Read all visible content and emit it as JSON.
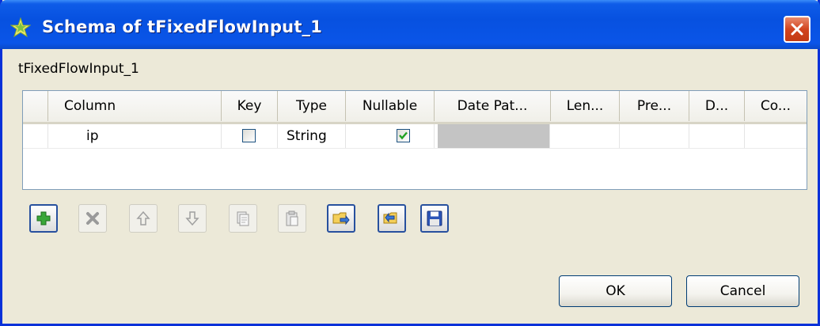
{
  "window": {
    "title": "Schema of tFixedFlowInput_1"
  },
  "component_label": "tFixedFlowInput_1",
  "table": {
    "columns": [
      "Column",
      "Key",
      "Type",
      "Nullable",
      "Date Pat...",
      "Len...",
      "Pre...",
      "D...",
      "Co..."
    ],
    "rows": [
      {
        "column": "ip",
        "key": false,
        "type": "String",
        "nullable": true,
        "date_pattern": "",
        "length": "",
        "precision": "",
        "default": "",
        "comment": ""
      }
    ]
  },
  "toolbar": [
    {
      "name": "add-button",
      "icon": "plus-icon",
      "enabled": true
    },
    {
      "name": "remove-button",
      "icon": "x-icon",
      "enabled": false
    },
    {
      "name": "move-up-button",
      "icon": "arrow-up-icon",
      "enabled": false
    },
    {
      "name": "move-down-button",
      "icon": "arrow-down-icon",
      "enabled": false
    },
    {
      "name": "copy-button",
      "icon": "copy-icon",
      "enabled": false
    },
    {
      "name": "paste-button",
      "icon": "paste-icon",
      "enabled": false
    },
    {
      "name": "import-button",
      "icon": "folder-import-icon",
      "enabled": true
    },
    {
      "name": "export-button",
      "icon": "folder-export-icon",
      "enabled": true
    },
    {
      "name": "save-button",
      "icon": "floppy-disk-icon",
      "enabled": true
    }
  ],
  "buttons": {
    "ok": "OK",
    "cancel": "Cancel"
  },
  "colors": {
    "titlebar": "#0751e0",
    "accent_green": "#3aa73a",
    "close": "#d2441e"
  }
}
